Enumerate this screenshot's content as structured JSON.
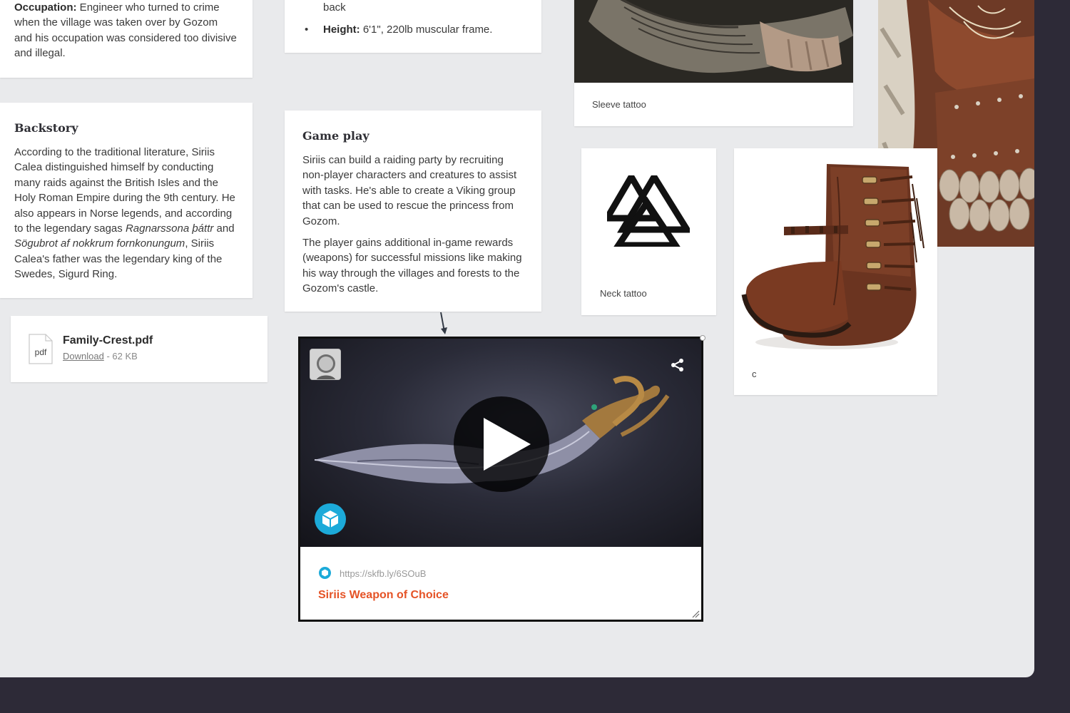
{
  "occupation": {
    "label": "Occupation:",
    "text": " Engineer who turned to crime when the village was taken over by Gozom and his occupation was considered too divisive and illegal."
  },
  "traits": {
    "line_cont": "back",
    "height_label": "Height:",
    "height_text": " 6'1\", 220lb muscular frame."
  },
  "backstory": {
    "title": "Backstory",
    "text_1": "According to the traditional literature, Siriis Calea distinguished himself by conducting many raids against the British Isles and the Holy Roman Empire during the 9th century. He also appears in Norse legends, and according to the legendary sagas ",
    "italic_1": "Ragnarssona þáttr",
    "text_2": " and ",
    "italic_2": "Sögubrot af nokkrum fornkonungum",
    "text_3": ", Siriis Calea's father was the legendary king of the Swedes, Sigurd Ring."
  },
  "gameplay": {
    "title": "Game play",
    "para_1": "Siriis can build a raiding party by recruiting non-player characters and creatures to assist with tasks. He's able to create a Viking group that can be used to rescue the princess from Gozom.",
    "para_2": "The player gains additional in-game rewards (weapons) for successful missions like making his way through the villages and forests to the Gozom's castle."
  },
  "file": {
    "icon_label": "pdf",
    "name": "Family-Crest.pdf",
    "download": "Download",
    "size": " - 62 KB"
  },
  "images": {
    "sleeve_caption": "Sleeve tattoo",
    "neck_caption": "Neck tattoo",
    "boot_caption": "c"
  },
  "embed": {
    "url": "https://skfb.ly/6SOuB",
    "title": "Siriis Weapon of Choice"
  },
  "colors": {
    "canvas": "#e9eaec",
    "frame": "#2d2a37",
    "link_title": "#e55326",
    "sketchfab": "#1caad9"
  }
}
